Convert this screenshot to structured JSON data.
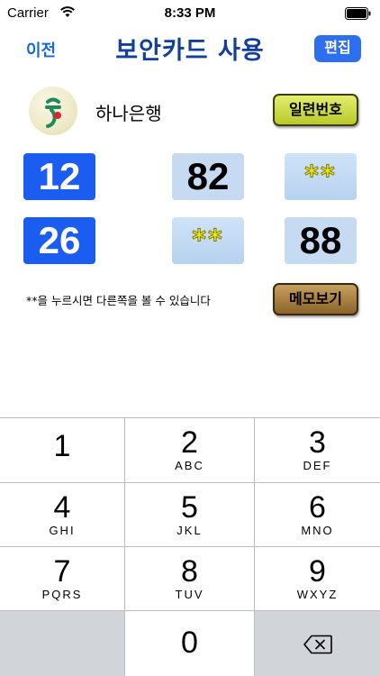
{
  "status": {
    "carrier": "Carrier",
    "time": "8:33 PM"
  },
  "nav": {
    "back_label": "이전",
    "title": "보안카드 사용",
    "edit_label": "편집"
  },
  "bank": {
    "name": "하나은행",
    "serial_label": "일련번호",
    "logo_glyph": "ㅎ"
  },
  "codes": [
    {
      "label": "12",
      "value": "82",
      "hidden": "**"
    },
    {
      "label": "26",
      "hidden": "**",
      "value": "88"
    }
  ],
  "hint": "**을 누르시면 다른쪽을 볼 수 있습니다",
  "memo_label": "메모보기",
  "keypad": [
    {
      "digit": "1",
      "letters": ""
    },
    {
      "digit": "2",
      "letters": "ABC"
    },
    {
      "digit": "3",
      "letters": "DEF"
    },
    {
      "digit": "4",
      "letters": "GHI"
    },
    {
      "digit": "5",
      "letters": "JKL"
    },
    {
      "digit": "6",
      "letters": "MNO"
    },
    {
      "digit": "7",
      "letters": "PQRS"
    },
    {
      "digit": "8",
      "letters": "TUV"
    },
    {
      "digit": "9",
      "letters": "WXYZ"
    },
    {
      "digit": "0",
      "letters": ""
    }
  ],
  "icons": {
    "delete": "backspace-icon",
    "wifi": "wifi-icon",
    "battery": "battery-icon"
  },
  "colors": {
    "accent": "#2e6ff0",
    "title": "#123f9c",
    "code_label_bg": "#1a5df0",
    "code_value_bg": "#c6dbf2",
    "hidden_star": "#f2ef1f",
    "bank_green": "#1f8a5a",
    "bank_red": "#d8262f"
  }
}
